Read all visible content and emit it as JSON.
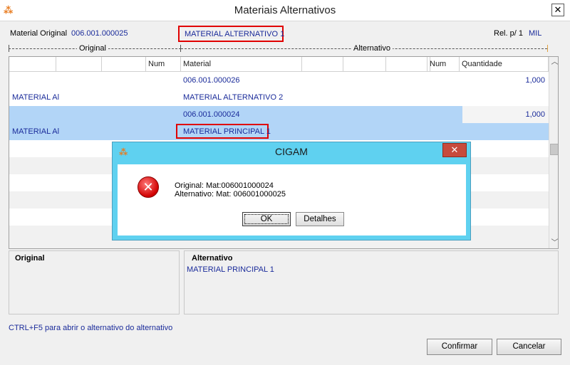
{
  "window": {
    "title": "Materiais Alternativos",
    "close_glyph": "✕"
  },
  "header": {
    "original_label": "Material Original",
    "original_code": "006.001.000025",
    "alternative_name": "MATERIAL ALTERNATIVO 1",
    "rel_label": "Rel. p/ 1",
    "rel_unit": "MIL"
  },
  "groups": {
    "original": "Original",
    "alternativo": "Alternativo"
  },
  "grid": {
    "headers": [
      "",
      "",
      "",
      "Num",
      "Material",
      "",
      "",
      "",
      "",
      "Num",
      "Quantidade"
    ],
    "rows": [
      {
        "left": "",
        "material": "006.001.000026",
        "quantity": "1,000",
        "selected": false
      },
      {
        "left": "MATERIAL Al",
        "material": "MATERIAL ALTERNATIVO 2",
        "quantity": "",
        "selected": false
      },
      {
        "left": "",
        "material": "006.001.000024",
        "quantity": "1,000",
        "selected": true
      },
      {
        "left": "MATERIAL Al",
        "material": "MATERIAL PRINCIPAL 1",
        "quantity": "",
        "selected": true
      }
    ]
  },
  "panels": {
    "original_title": "Original",
    "alternativo_title": "Alternativo",
    "alternativo_value": "MATERIAL PRINCIPAL 1"
  },
  "footer": {
    "hint": "CTRL+F5 para abrir o alternativo do alternativo",
    "confirm": "Confirmar",
    "cancel": "Cancelar"
  },
  "dialog": {
    "title": "CIGAM",
    "close_glyph": "✕",
    "line1": "Original: Mat:006001000024",
    "line2": "Alternativo: Mat: 006001000025",
    "ok": "OK",
    "details": "Detalhes"
  },
  "colors": {
    "accent_blue": "#1a2b9a",
    "highlight_red": "#e00000",
    "selection": "#b2d5f7",
    "dialog_frame": "#5fd1f0"
  },
  "icons": {
    "app": "cigam-logo-icon",
    "error": "error-icon"
  }
}
